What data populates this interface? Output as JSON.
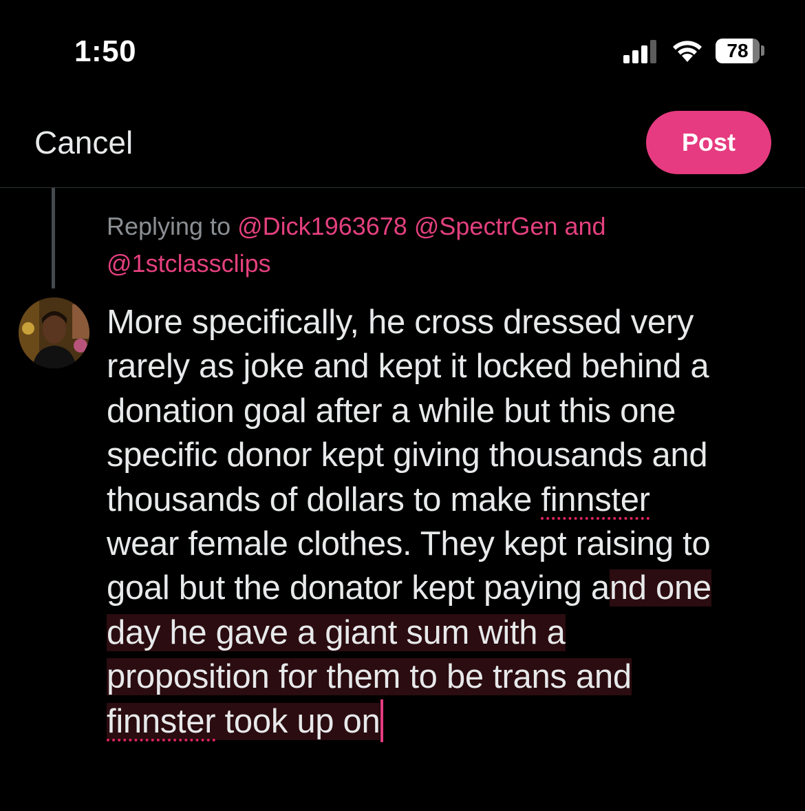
{
  "status_bar": {
    "time": "1:50",
    "battery": "78",
    "icons": [
      "cellular-signal-icon",
      "wifi-icon",
      "battery-icon"
    ]
  },
  "header": {
    "cancel_label": "Cancel",
    "post_label": "Post"
  },
  "reply": {
    "prefix": "Replying to",
    "mention_1": "@Dick1963678",
    "mention_2": "@SpectrGen",
    "conjunction": "and",
    "mention_3": "@1stclassclips"
  },
  "composer": {
    "lines": [
      "More specifically, he cross dressed very",
      "rarely as joke and kept it locked behind a",
      "donation goal after a while but this one",
      "specific donor kept giving thousands and",
      "thousands of dollars to make ",
      "finnster",
      "wear female clothes. They kept raising to",
      "goal but the donator kept paying a",
      "nd one",
      "day he gave a giant sum with a",
      "proposition for them to be trans and",
      "finnster",
      " took up on"
    ]
  },
  "colors": {
    "accent": "#e63b80",
    "mention": "#e4407e",
    "background": "#000000",
    "selection": "#2b0c10"
  }
}
